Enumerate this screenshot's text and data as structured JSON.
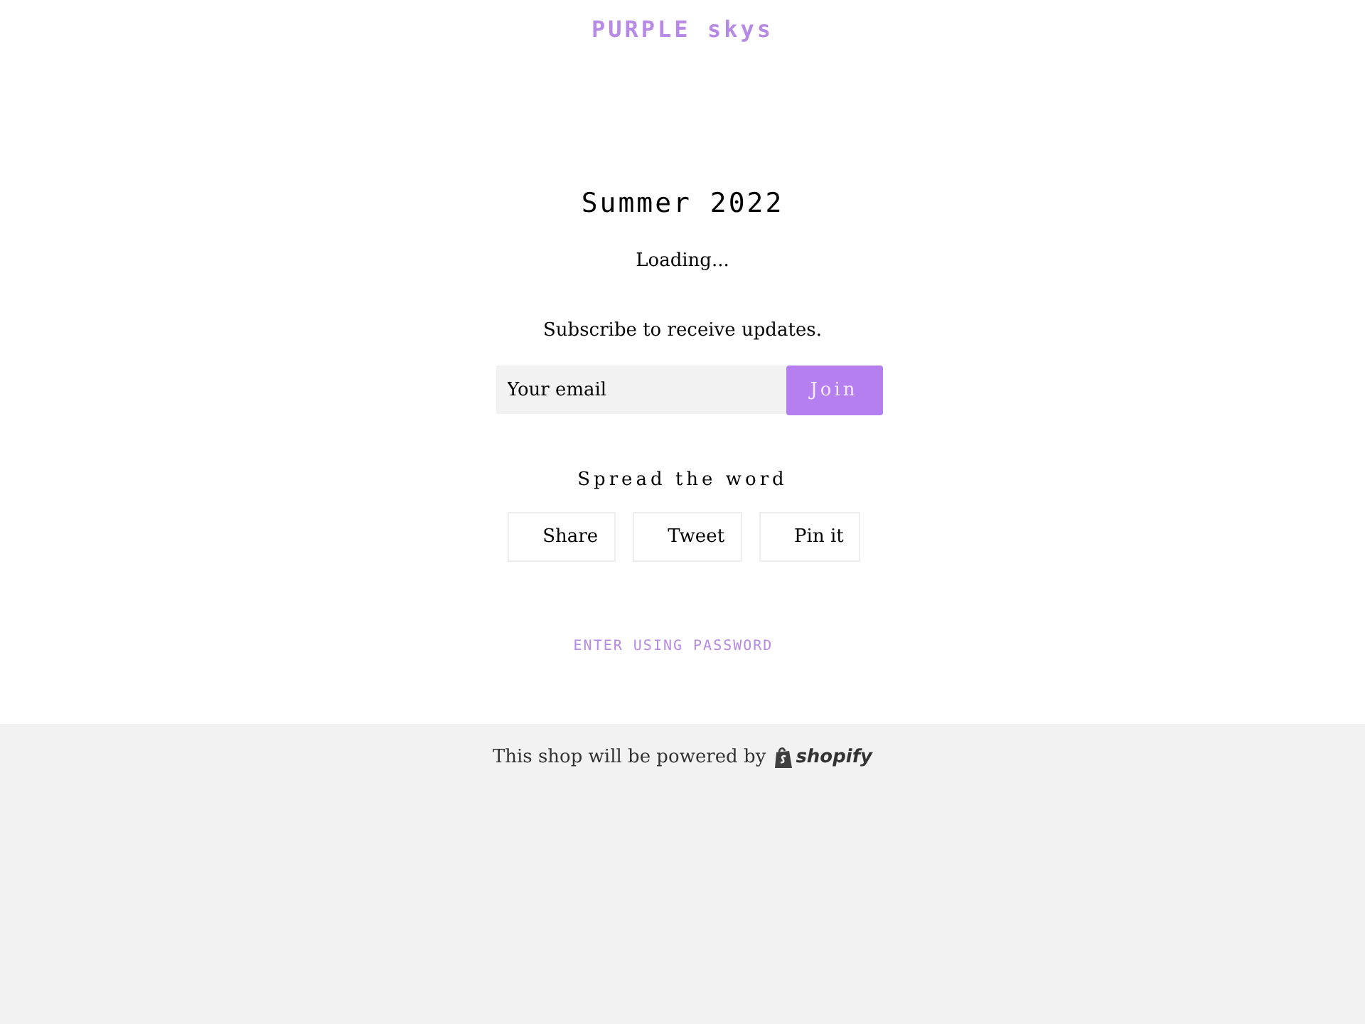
{
  "header": {
    "shop_name": "PURPLE skys"
  },
  "main": {
    "title": "Summer 2022",
    "status": "Loading...",
    "subscribe_text": "Subscribe to receive updates.",
    "email_field": {
      "placeholder": "Your email"
    },
    "join_button": "Join",
    "share_heading": "Spread the word",
    "share_buttons": [
      "Share",
      "Tweet",
      "Pin it"
    ],
    "password_link": "ENTER USING PASSWORD"
  },
  "footer": {
    "text": "This shop will be powered by",
    "logo_text": "shopify"
  }
}
